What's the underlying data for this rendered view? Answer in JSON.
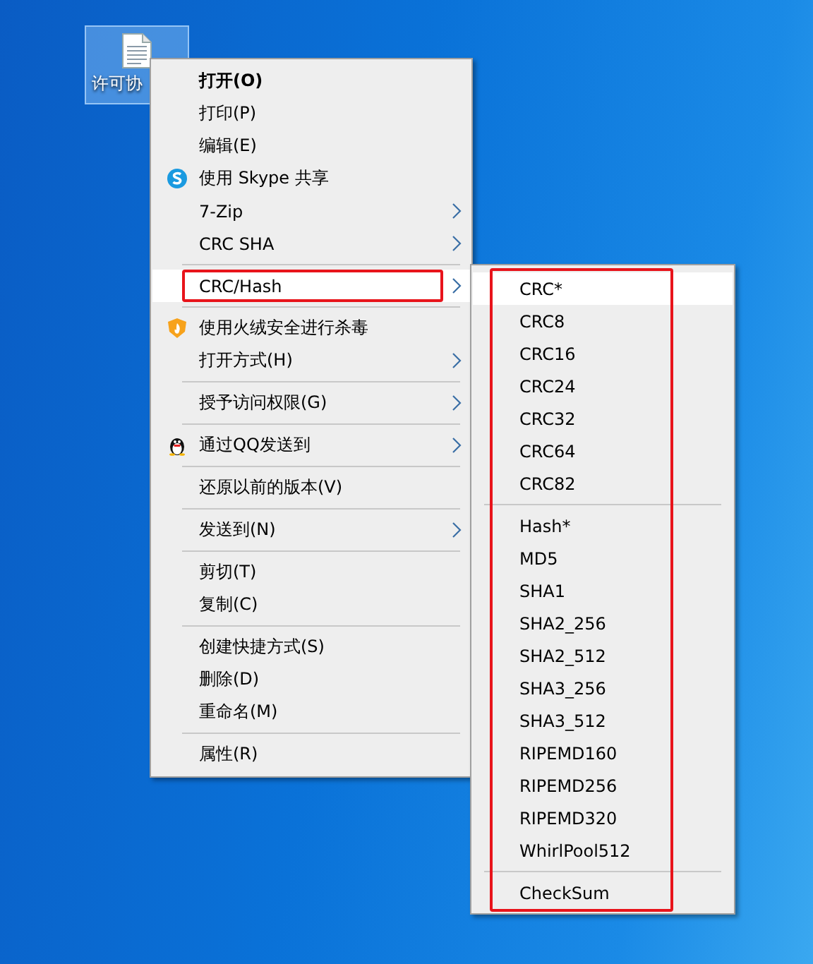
{
  "desktop": {
    "icon": {
      "label": "许可协",
      "selected": true
    }
  },
  "context_menu": {
    "items": [
      {
        "kind": "item",
        "label": "打开(O)",
        "bold": true,
        "submenu": false,
        "selected": false,
        "outlined": false
      },
      {
        "kind": "item",
        "label": "打印(P)",
        "bold": false,
        "submenu": false,
        "selected": false,
        "outlined": false
      },
      {
        "kind": "item",
        "label": "编辑(E)",
        "bold": false,
        "submenu": false,
        "selected": false,
        "outlined": false
      },
      {
        "kind": "item",
        "label": "使用 Skype 共享",
        "bold": false,
        "submenu": false,
        "selected": false,
        "outlined": false
      },
      {
        "kind": "item",
        "label": "7-Zip",
        "bold": false,
        "submenu": true,
        "selected": false,
        "outlined": false
      },
      {
        "kind": "item",
        "label": "CRC SHA",
        "bold": false,
        "submenu": true,
        "selected": false,
        "outlined": false
      },
      {
        "kind": "separator"
      },
      {
        "kind": "item",
        "label": "CRC/Hash",
        "bold": false,
        "submenu": true,
        "selected": true,
        "outlined": true
      },
      {
        "kind": "separator"
      },
      {
        "kind": "item",
        "label": "使用火绒安全进行杀毒",
        "bold": false,
        "submenu": false,
        "selected": false,
        "outlined": false
      },
      {
        "kind": "item",
        "label": "打开方式(H)",
        "bold": false,
        "submenu": true,
        "selected": false,
        "outlined": false
      },
      {
        "kind": "separator"
      },
      {
        "kind": "item",
        "label": "授予访问权限(G)",
        "bold": false,
        "submenu": true,
        "selected": false,
        "outlined": false
      },
      {
        "kind": "separator"
      },
      {
        "kind": "item",
        "label": "通过QQ发送到",
        "bold": false,
        "submenu": true,
        "selected": false,
        "outlined": false
      },
      {
        "kind": "separator"
      },
      {
        "kind": "item",
        "label": "还原以前的版本(V)",
        "bold": false,
        "submenu": false,
        "selected": false,
        "outlined": false
      },
      {
        "kind": "separator"
      },
      {
        "kind": "item",
        "label": "发送到(N)",
        "bold": false,
        "submenu": true,
        "selected": false,
        "outlined": false
      },
      {
        "kind": "separator"
      },
      {
        "kind": "item",
        "label": "剪切(T)",
        "bold": false,
        "submenu": false,
        "selected": false,
        "outlined": false
      },
      {
        "kind": "item",
        "label": "复制(C)",
        "bold": false,
        "submenu": false,
        "selected": false,
        "outlined": false
      },
      {
        "kind": "separator"
      },
      {
        "kind": "item",
        "label": "创建快捷方式(S)",
        "bold": false,
        "submenu": false,
        "selected": false,
        "outlined": false
      },
      {
        "kind": "item",
        "label": "删除(D)",
        "bold": false,
        "submenu": false,
        "selected": false,
        "outlined": false
      },
      {
        "kind": "item",
        "label": "重命名(M)",
        "bold": false,
        "submenu": false,
        "selected": false,
        "outlined": false
      },
      {
        "kind": "separator"
      },
      {
        "kind": "item",
        "label": "属性(R)",
        "bold": false,
        "submenu": false,
        "selected": false,
        "outlined": false
      }
    ]
  },
  "submenu": {
    "outlined": true,
    "items": [
      {
        "kind": "item",
        "label": "CRC*",
        "selected": true
      },
      {
        "kind": "item",
        "label": "CRC8",
        "selected": false
      },
      {
        "kind": "item",
        "label": "CRC16",
        "selected": false
      },
      {
        "kind": "item",
        "label": "CRC24",
        "selected": false
      },
      {
        "kind": "item",
        "label": "CRC32",
        "selected": false
      },
      {
        "kind": "item",
        "label": "CRC64",
        "selected": false
      },
      {
        "kind": "item",
        "label": "CRC82",
        "selected": false
      },
      {
        "kind": "separator"
      },
      {
        "kind": "item",
        "label": "Hash*",
        "selected": false
      },
      {
        "kind": "item",
        "label": "MD5",
        "selected": false
      },
      {
        "kind": "item",
        "label": "SHA1",
        "selected": false
      },
      {
        "kind": "item",
        "label": "SHA2_256",
        "selected": false
      },
      {
        "kind": "item",
        "label": "SHA2_512",
        "selected": false
      },
      {
        "kind": "item",
        "label": "SHA3_256",
        "selected": false
      },
      {
        "kind": "item",
        "label": "SHA3_512",
        "selected": false
      },
      {
        "kind": "item",
        "label": "RIPEMD160",
        "selected": false
      },
      {
        "kind": "item",
        "label": "RIPEMD256",
        "selected": false
      },
      {
        "kind": "item",
        "label": "RIPEMD320",
        "selected": false
      },
      {
        "kind": "item",
        "label": "WhirlPool512",
        "selected": false
      },
      {
        "kind": "separator"
      },
      {
        "kind": "item",
        "label": "CheckSum",
        "selected": false
      }
    ]
  }
}
